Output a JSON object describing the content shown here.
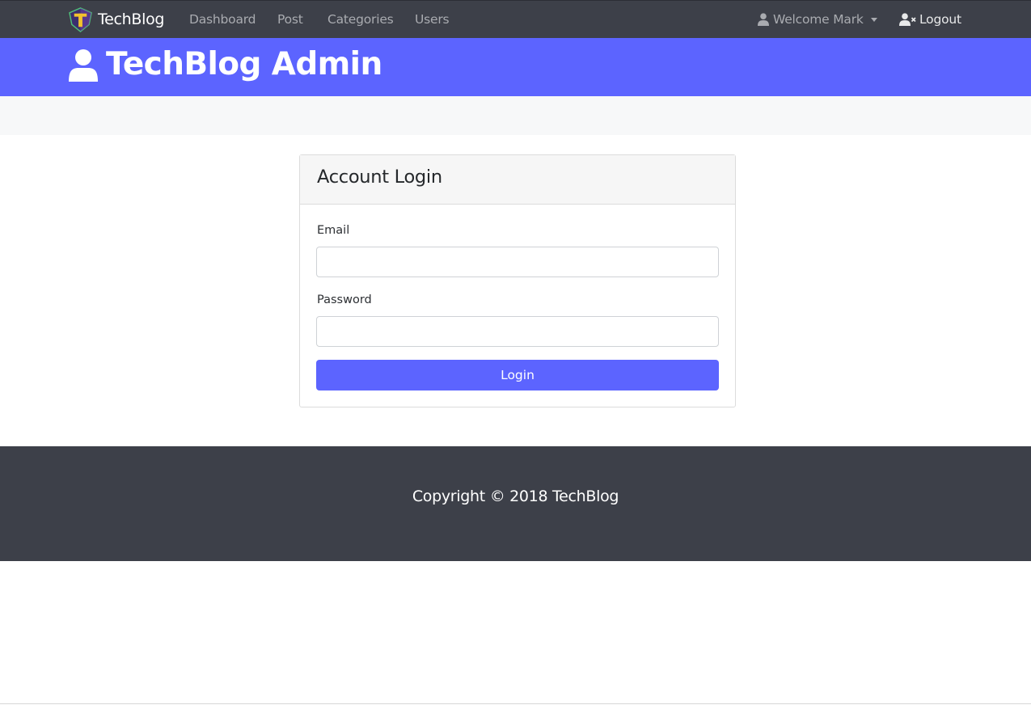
{
  "navbar": {
    "brand": "TechBlog",
    "links": [
      "Dashboard",
      "Post",
      "Categories",
      "Users"
    ],
    "welcome": "Welcome Mark",
    "logout": "Logout",
    "background": "#3d4049"
  },
  "hero": {
    "title": "TechBlog Admin",
    "background": "#5c64ff"
  },
  "login": {
    "title": "Account Login",
    "email_label": "Email",
    "email_value": "",
    "password_label": "Password",
    "password_value": "",
    "button": "Login",
    "accent": "#5c64ff"
  },
  "footer": {
    "text": "Copyright © 2018 TechBlog"
  },
  "icons": {
    "brand": "techblog-logo-icon",
    "user": "user-icon",
    "logout": "user-times-icon",
    "hero": "user-icon",
    "dropdown": "caret-down-icon"
  }
}
